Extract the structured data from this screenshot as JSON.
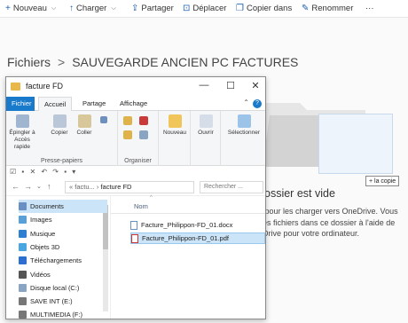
{
  "onedrive": {
    "commands": [
      {
        "icon": "plus-icon",
        "label": "Nouveau",
        "chevron": true
      },
      {
        "icon": "upload-icon",
        "label": "Charger",
        "chevron": true
      },
      {
        "icon": "share-icon",
        "label": "Partager",
        "chevron": false
      },
      {
        "icon": "move-icon",
        "label": "Déplacer",
        "chevron": false
      },
      {
        "icon": "copy-icon",
        "label": "Copier dans",
        "chevron": false
      },
      {
        "icon": "rename-icon",
        "label": "Renommer",
        "chevron": false
      },
      {
        "icon": "more-icon",
        "label": "···",
        "chevron": false
      }
    ],
    "breadcrumb": {
      "root": "Fichiers",
      "separator": ">",
      "current": "SAUVEGARDE ANCIEN PC FACTURES"
    },
    "empty_title": "ossier est vide",
    "empty_desc": "p pour les charger vers OneDrive. Vous des fichiers dans ce dossier à l'aide de eDrive pour votre ordinateur.",
    "drag_tooltip": "+ la copie"
  },
  "explorer": {
    "title": "facture FD",
    "window_controls": {
      "minimize": "—",
      "maximize": "☐",
      "close": "✕"
    },
    "tabs": [
      {
        "label": "Fichier"
      },
      {
        "label": "Accueil"
      },
      {
        "label": "Partage"
      },
      {
        "label": "Affichage"
      }
    ],
    "ribbon": {
      "pin_label": "Épingler à Accès rapide",
      "copy_label": "Copier",
      "paste_label": "Coller",
      "clipboard_group": "Presse-papiers",
      "organize_group": "Organiser",
      "new_label": "Nouveau",
      "open_label": "Ouvrir",
      "select_label": "Sélectionner"
    },
    "address": {
      "back": "←",
      "forward": "→",
      "recent": "⌄",
      "up": "↑",
      "path_prefix": "« factu...",
      "path_sep": "›",
      "path_current": "facture FD",
      "search_placeholder": "Rechercher ..."
    },
    "nav_items": [
      {
        "label": "Documents",
        "icon": "documents-icon",
        "color": "#6a8fc2",
        "selected": true
      },
      {
        "label": "Images",
        "icon": "images-icon",
        "color": "#5aa0d8",
        "selected": false
      },
      {
        "label": "Musique",
        "icon": "music-icon",
        "color": "#2d7fd1",
        "selected": false
      },
      {
        "label": "Objets 3D",
        "icon": "objects3d-icon",
        "color": "#4aa6e0",
        "selected": false
      },
      {
        "label": "Téléchargements",
        "icon": "downloads-icon",
        "color": "#2d6fd1",
        "selected": false
      },
      {
        "label": "Vidéos",
        "icon": "videos-icon",
        "color": "#555555",
        "selected": false
      },
      {
        "label": "Disque local (C:)",
        "icon": "drive-icon",
        "color": "#8aa4c4",
        "selected": false
      },
      {
        "label": "SAVE INT (E:)",
        "icon": "drive-icon",
        "color": "#777777",
        "selected": false
      },
      {
        "label": "MULTIMEDIA (F:)",
        "icon": "drive-icon",
        "color": "#777777",
        "selected": false
      }
    ],
    "column_header": "Nom",
    "files": [
      {
        "name": "Facture_Philippon-FD_01.docx",
        "type": "docx",
        "selected": false
      },
      {
        "name": "Facture_Philippon-FD_01.pdf",
        "type": "pdf",
        "selected": true
      }
    ]
  }
}
